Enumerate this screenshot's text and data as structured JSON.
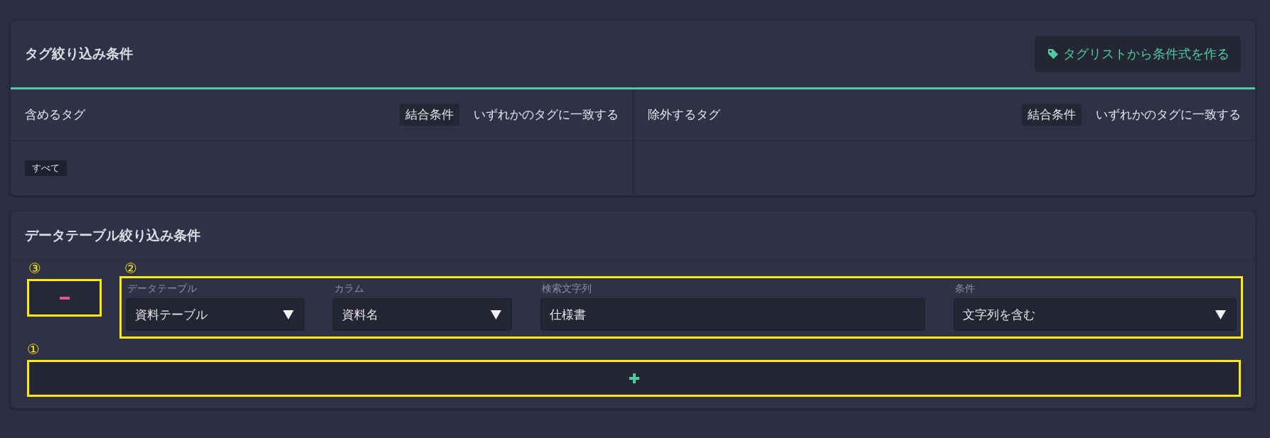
{
  "tag_filter": {
    "title": "タグ絞り込み条件",
    "build_button": {
      "label": "タグリストから条件式を作る"
    },
    "columns": [
      {
        "label": "含めるタグ",
        "join_label": "結合条件",
        "join_value": "いずれかのタグに一致する",
        "tags": [
          "すべて"
        ]
      },
      {
        "label": "除外するタグ",
        "join_label": "結合条件",
        "join_value": "いずれかのタグに一致する"
      }
    ]
  },
  "table_filter": {
    "title": "データテーブル絞り込み条件",
    "remove_marker": "③",
    "conditions_marker": "②",
    "add_marker": "①",
    "conditions": [
      {
        "kind": "select",
        "label": "データテーブル",
        "value": "資料テーブル"
      },
      {
        "kind": "select",
        "label": "カラム",
        "value": "資料名"
      },
      {
        "kind": "text",
        "label": "検索文字列",
        "value": "仕様書"
      },
      {
        "kind": "select",
        "label": "条件",
        "value": "文字列を含む"
      }
    ]
  }
}
